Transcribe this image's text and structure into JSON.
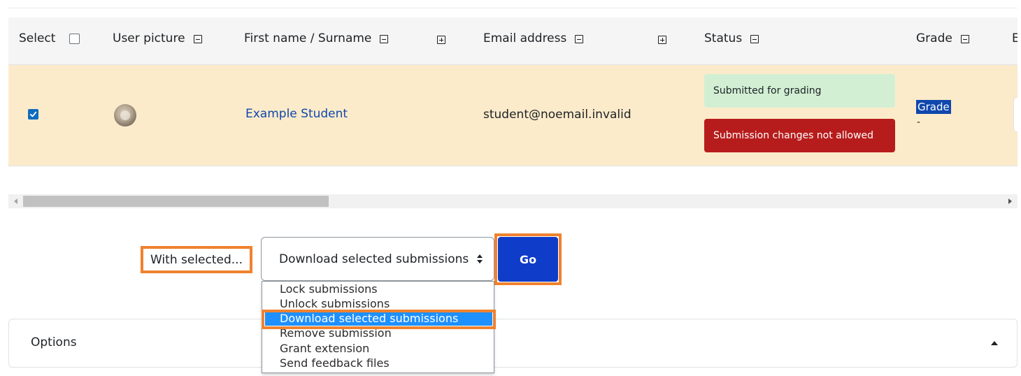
{
  "table": {
    "headers": {
      "select": "Select",
      "user_picture": "User picture",
      "name": "First name / Surname",
      "email": "Email address",
      "status": "Status",
      "grade": "Grade",
      "next_col": "E"
    },
    "row": {
      "checked": true,
      "name": "Example Student",
      "email": "student@noemail.invalid",
      "status_submitted": "Submitted for grading",
      "status_locked": "Submission changes not allowed",
      "grade_label": "Grade",
      "grade_value": "-"
    }
  },
  "bulk_actions": {
    "label": "With selected...",
    "selected_value": "Download selected submissions",
    "go_label": "Go",
    "options": [
      "Lock submissions",
      "Unlock submissions",
      "Download selected submissions",
      "Remove submission",
      "Grant extension",
      "Send feedback files"
    ]
  },
  "options_section": {
    "title": "Options"
  },
  "colors": {
    "row_highlight": "#fcebca",
    "link": "#0f47ad",
    "badge_success": "#d2efd4",
    "badge_danger": "#b71c1c",
    "primary_button": "#0f3cc9",
    "annotation_highlight": "#f0822f",
    "option_selected": "#1e90ff"
  },
  "icons": {
    "hide_column": "minus-square-icon",
    "show_column": "plus-square-icon",
    "select_caret": "sort-caret-icon",
    "collapse": "caret-up-icon"
  }
}
